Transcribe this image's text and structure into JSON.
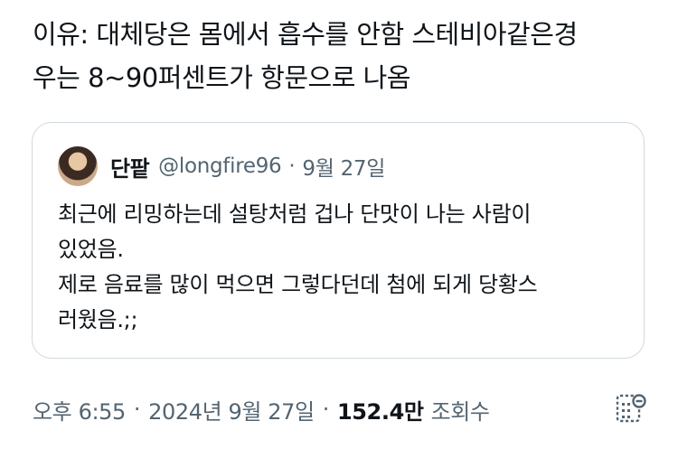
{
  "tweet": {
    "text": "이유: 대체당은 몸에서 흡수를 안함 스테비아같은경\n우는 8~90퍼센트가 항문으로 나옴"
  },
  "quote": {
    "name": "단팥",
    "handle": "@longfire96",
    "separator": "·",
    "date": "9월 27일",
    "body": "최근에 리밍하는데 설탕처럼 겁나 단맛이 나는 사람이\n있었음.\n제로 음료를 많이 먹으면 그렇다던데 첨에 되게 당황스\n러웠음.;;"
  },
  "meta": {
    "time": "오후 6:55",
    "separator": "·",
    "date": "2024년 9월 27일",
    "views": "152.4만",
    "views_label": "조회수"
  },
  "icons": {
    "analytics": "analytics-icon",
    "avatar": "avatar"
  },
  "colors": {
    "text": "#0f1419",
    "secondary": "#536471",
    "border": "#cfd9de"
  }
}
